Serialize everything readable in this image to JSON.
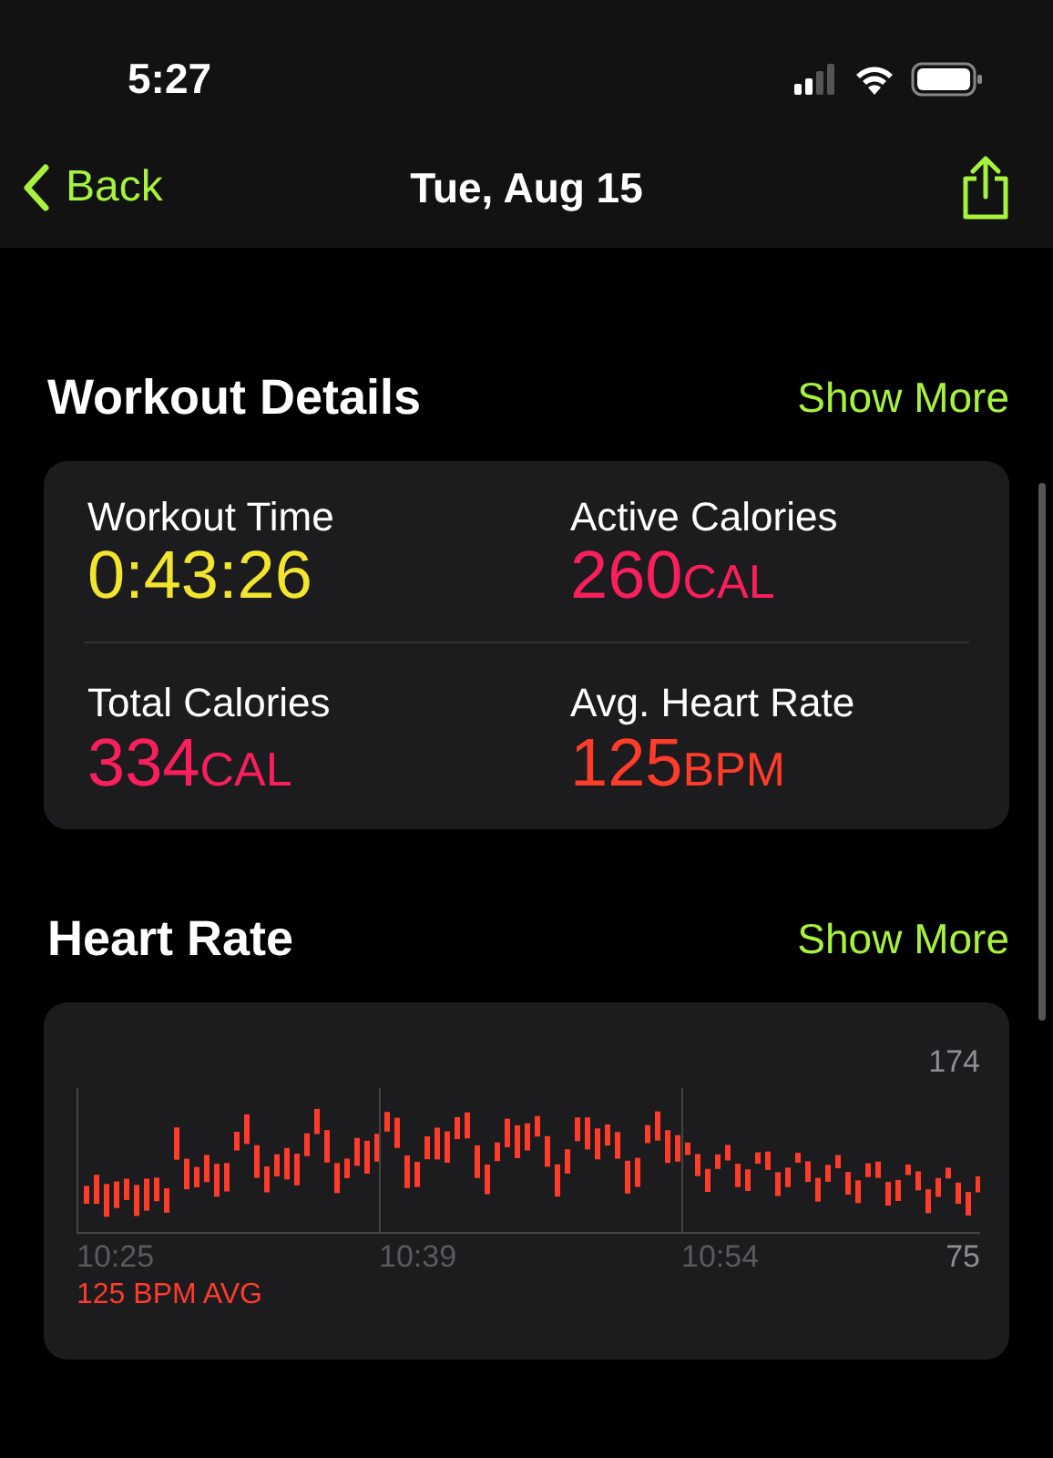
{
  "status_bar": {
    "time": "5:27"
  },
  "nav": {
    "back": "Back",
    "title": "Tue, Aug 15"
  },
  "workout_details": {
    "title": "Workout Details",
    "action": "Show More",
    "metrics": [
      {
        "label": "Workout Time",
        "value": "0:43:26",
        "color": "#f2e52d"
      },
      {
        "label": "Active Calories",
        "value": "260",
        "unit": "CAL",
        "color": "#fa1f5c"
      },
      {
        "label": "Total Calories",
        "value": "334",
        "unit": "CAL",
        "color": "#fa1f5c"
      },
      {
        "label": "Avg. Heart Rate",
        "value": "125",
        "unit": "BPM",
        "color": "#ff3b2a"
      }
    ]
  },
  "heart_rate": {
    "title": "Heart Rate",
    "action": "Show More",
    "max": "174",
    "min": "75",
    "times": [
      "10:25",
      "10:39",
      "10:54"
    ],
    "average": "125 BPM AVG"
  }
}
